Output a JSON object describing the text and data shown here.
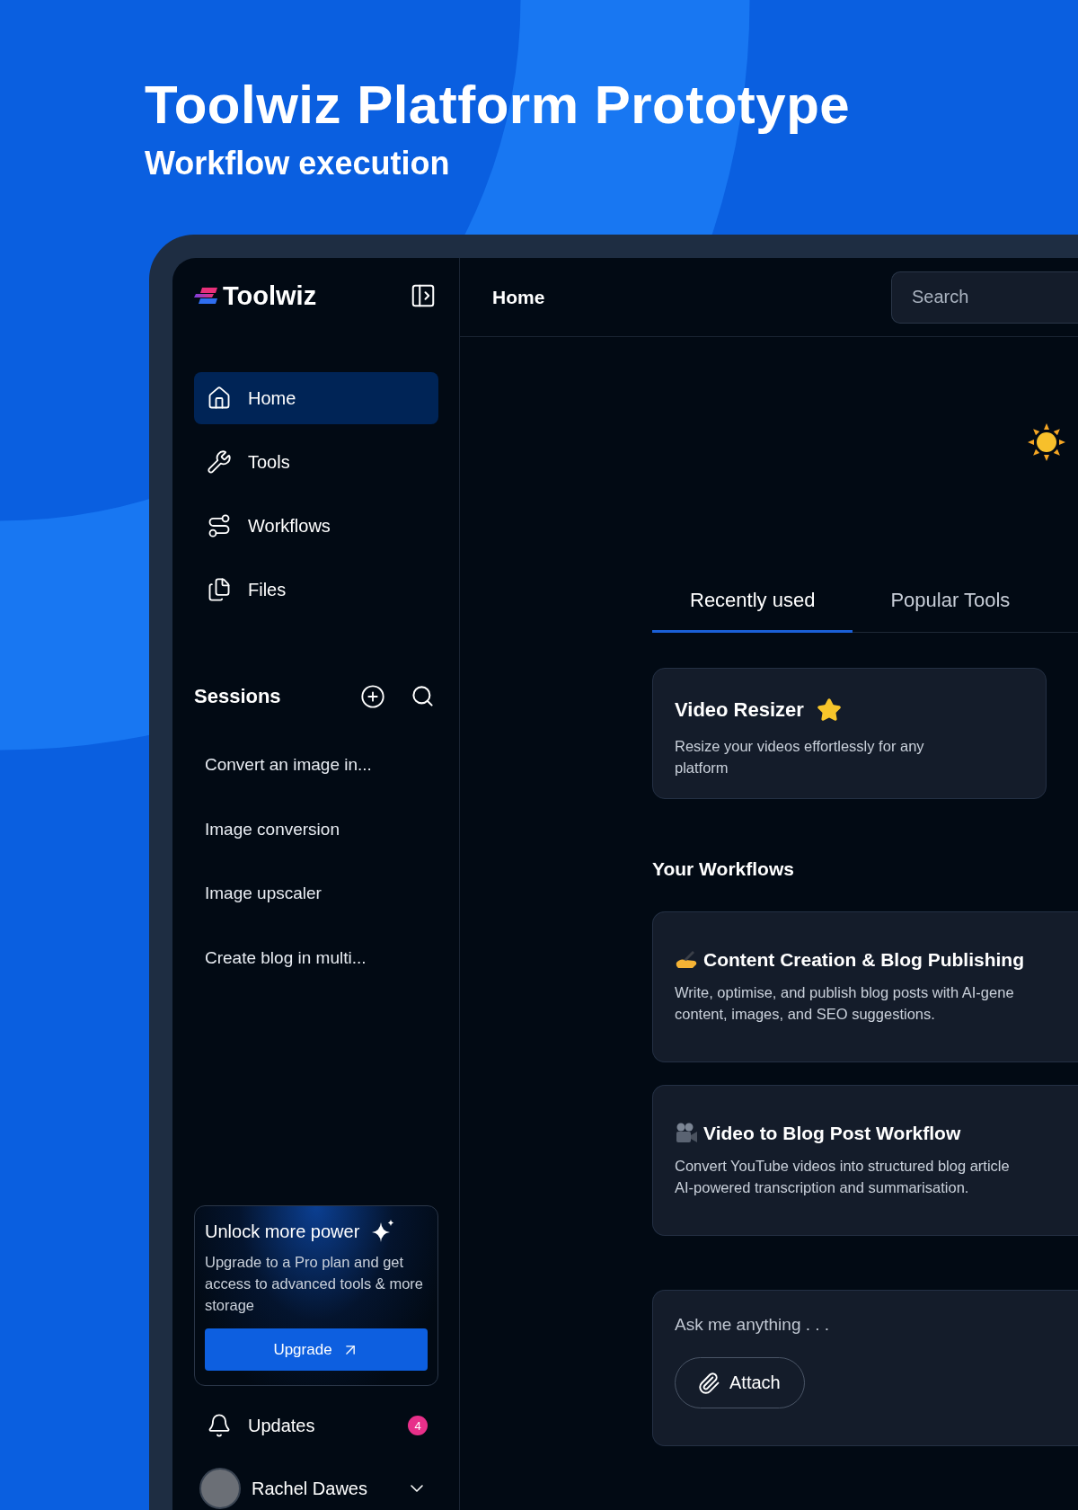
{
  "hero": {
    "title": "Toolwiz Platform Prototype",
    "subtitle": "Workflow execution"
  },
  "sidebar": {
    "logo": "Toolwiz",
    "nav": [
      {
        "label": "Home",
        "kind": "home",
        "selected": true
      },
      {
        "label": "Tools",
        "kind": "tools",
        "selected": false
      },
      {
        "label": "Workflows",
        "kind": "workflows",
        "selected": false
      },
      {
        "label": "Files",
        "kind": "files",
        "selected": false
      }
    ],
    "sessions": {
      "title": "Sessions",
      "items": [
        "Convert an image in...",
        "Image conversion",
        "Image upscaler",
        "Create blog in multi..."
      ]
    },
    "promo": {
      "title": "Unlock more power",
      "body": "Upgrade to a Pro plan and get access to advanced tools & more storage",
      "button": "Upgrade"
    },
    "updates": {
      "label": "Updates",
      "badge": "4"
    },
    "user": {
      "name": "Rachel Dawes"
    }
  },
  "header": {
    "title": "Home",
    "search": {
      "placeholder": "Search"
    }
  },
  "tabs": [
    {
      "label": "Recently used",
      "selected": true
    },
    {
      "label": "Popular Tools",
      "selected": false
    }
  ],
  "recent": [
    {
      "title": "Video Resizer",
      "favorite": true,
      "description": "Resize your videos effortlessly for any platform"
    }
  ],
  "workflows": {
    "title": "Your Workflows",
    "items": [
      {
        "kind": "writing",
        "title": "Content Creation & Blog Publishing",
        "lines": [
          "Write, optimise, and publish blog posts with AI-gene",
          "content, images, and SEO suggestions."
        ]
      },
      {
        "kind": "video",
        "title": "Video to Blog Post Workflow",
        "lines": [
          "Convert YouTube videos into structured blog article",
          "AI-powered transcription and summarisation."
        ]
      }
    ]
  },
  "chat": {
    "placeholder": "Ask me anything . . .",
    "attach": "Attach"
  }
}
